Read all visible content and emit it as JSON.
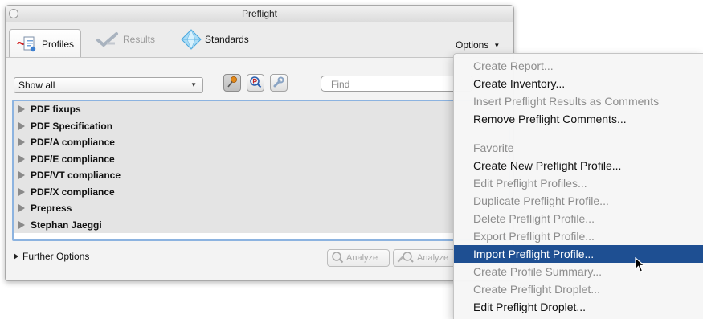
{
  "window": {
    "title": "Preflight"
  },
  "tabs": [
    {
      "label": "Profiles",
      "icon": "profiles-icon",
      "state": "active"
    },
    {
      "label": "Results",
      "icon": "results-icon",
      "state": "disabled"
    },
    {
      "label": "Standards",
      "icon": "standards-icon",
      "state": "normal"
    }
  ],
  "options": {
    "label": "Options"
  },
  "filter": {
    "selected": "Show all"
  },
  "find": {
    "placeholder": "Find"
  },
  "profiles": [
    "PDF fixups",
    "PDF Specification",
    "PDF/A compliance",
    "PDF/E compliance",
    "PDF/VT compliance",
    "PDF/X compliance",
    "Prepress",
    "Stephan Jaeggi"
  ],
  "further_options": {
    "label": "Further Options"
  },
  "buttons": {
    "analyze": "Analyze",
    "analyze_and_fix": "Analyze"
  },
  "menu": {
    "items": [
      {
        "label": "Create Report...",
        "enabled": false
      },
      {
        "label": "Create Inventory...",
        "enabled": true
      },
      {
        "label": "Insert Preflight Results as Comments",
        "enabled": false
      },
      {
        "label": "Remove Preflight Comments...",
        "enabled": true
      },
      {
        "label": "Favorite",
        "enabled": false
      },
      {
        "label": "Create New Preflight Profile...",
        "enabled": true
      },
      {
        "label": "Edit Preflight Profiles...",
        "enabled": false
      },
      {
        "label": "Duplicate Preflight Profile...",
        "enabled": false
      },
      {
        "label": "Delete Preflight Profile...",
        "enabled": false
      },
      {
        "label": "Export Preflight Profile...",
        "enabled": false
      },
      {
        "label": "Import Preflight Profile...",
        "enabled": true,
        "highlighted": true
      },
      {
        "label": "Create Profile Summary...",
        "enabled": false
      },
      {
        "label": "Create Preflight Droplet...",
        "enabled": false
      },
      {
        "label": "Edit Preflight Droplet...",
        "enabled": true
      }
    ]
  },
  "colors": {
    "highlight": "#1e4f92",
    "list_focus": "#8cb3e0",
    "disabled_text": "#8c8c8c"
  }
}
